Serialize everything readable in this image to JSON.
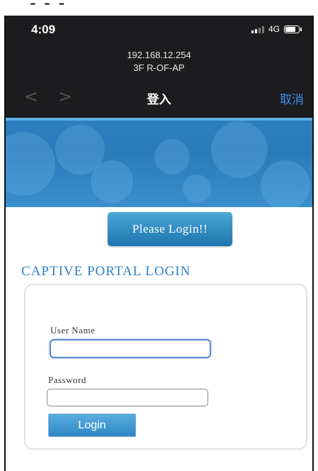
{
  "header": {
    "time": "4:09",
    "network": "4G",
    "address_line1": "192.168.12.254",
    "address_line2": "3F R-OF-AP",
    "back_glyph": "<",
    "forward_glyph": ">",
    "title": "登入",
    "cancel_label": "取消"
  },
  "content": {
    "please_login_label": "Please Login!!",
    "portal_title": "CAPTIVE PORTAL LOGIN",
    "form": {
      "username_label": "User Name",
      "username_value": "",
      "password_label": "Password",
      "password_value": "",
      "login_button_label": "Login"
    }
  },
  "colors": {
    "header_bg": "#1c1c1e",
    "cancel_link": "#3d8ff0",
    "banner_blue": "#2d7fbf",
    "portal_title": "#2a80c5",
    "button_blue": "#2d86c3"
  },
  "icons": [
    "signal-bars-icon",
    "battery-icon",
    "back-chevron-icon",
    "forward-chevron-icon"
  ]
}
